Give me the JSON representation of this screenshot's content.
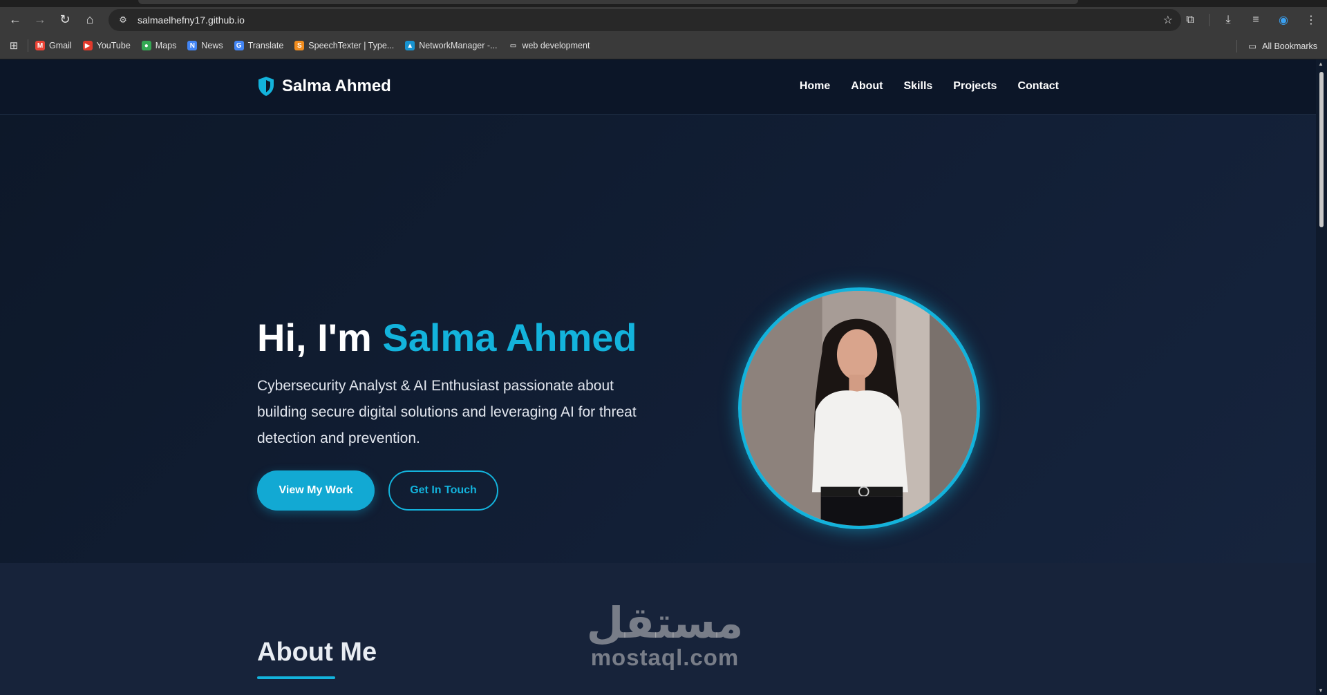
{
  "browser": {
    "url": "salmaelhefny17.github.io",
    "icons": [
      "back-icon",
      "forward-icon",
      "reload-icon",
      "home-icon",
      "site-settings-icon",
      "star-icon",
      "extensions-icon",
      "download-icon",
      "reading-list-icon",
      "copilot-icon",
      "menu-icon"
    ],
    "bookmarks": [
      {
        "label": "Gmail",
        "icon": "gmail-icon",
        "color": "#ea4335",
        "glyph": "M"
      },
      {
        "label": "YouTube",
        "icon": "youtube-icon",
        "color": "#e1392b",
        "glyph": "▶"
      },
      {
        "label": "Maps",
        "icon": "maps-icon",
        "color": "#34a853",
        "glyph": "●"
      },
      {
        "label": "News",
        "icon": "news-icon",
        "color": "#4285f4",
        "glyph": "N"
      },
      {
        "label": "Translate",
        "icon": "translate-icon",
        "color": "#4285f4",
        "glyph": "G"
      },
      {
        "label": "SpeechTexter | Type...",
        "icon": "speechtexter-icon",
        "color": "#f08c1e",
        "glyph": "S"
      },
      {
        "label": "NetworkManager -...",
        "icon": "networkmanager-icon",
        "color": "#1793d1",
        "glyph": "▲"
      },
      {
        "label": "web development",
        "icon": "folder-icon",
        "color": "#3a3a3a",
        "glyph": "▭"
      }
    ],
    "all_bookmarks": "All Bookmarks"
  },
  "site": {
    "brand": "Salma Ahmed",
    "nav": [
      "Home",
      "About",
      "Skills",
      "Projects",
      "Contact"
    ],
    "hero": {
      "greeting": "Hi, I'm ",
      "name": "Salma Ahmed",
      "description": "Cybersecurity Analyst & AI Enthusiast passionate about building secure digital solutions and leveraging AI for threat detection and prevention.",
      "primary_button": "View My Work",
      "secondary_button": "Get In Touch"
    },
    "about": {
      "title": "About Me"
    },
    "colors": {
      "accent": "#13b3dc",
      "background": "#0f1a2c"
    }
  },
  "watermark": {
    "arabic": "مستقل",
    "latin": "mostaql.com"
  }
}
